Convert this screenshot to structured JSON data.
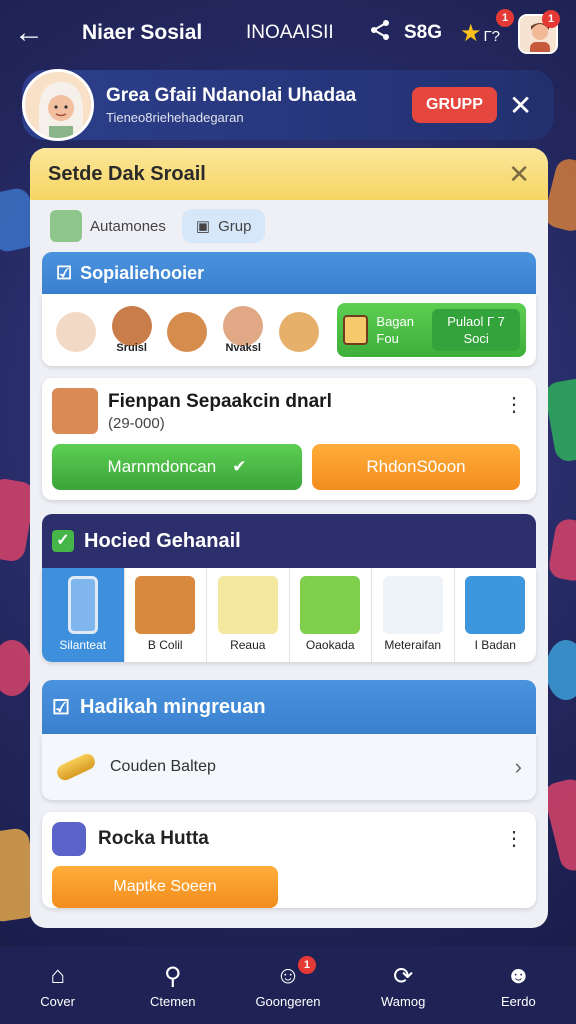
{
  "topbar": {
    "title": "Niaer Sosial",
    "subtitle": "INOAAISII",
    "score": "S8G",
    "star_count": "Г?",
    "notif_star": "1",
    "notif_avatar": "1"
  },
  "banner": {
    "name": "Grea Gfaii Ndanolai Uhadaa",
    "sub": "Tieneo8riehehadegaran",
    "button": "GRUPP"
  },
  "panel": {
    "title": "Setde Dak Sroail",
    "tabs": [
      {
        "label": "Autamones"
      },
      {
        "label": "Grup"
      }
    ],
    "section1": {
      "title": "Sopialiehooier",
      "friends": [
        {
          "name": ""
        },
        {
          "name": "Sruisl"
        },
        {
          "name": ""
        },
        {
          "name": "Nvaksl"
        },
        {
          "name": ""
        }
      ],
      "promo_text": "Bagan Fou",
      "promo_button": "Pulaol Г 7 Soci"
    },
    "request": {
      "name": "Fienpan Sepaakcin dnarl",
      "sub": "(29-000)",
      "accept": "Marnmdoncan",
      "decline": "RhdonS0oon"
    },
    "section2": {
      "title": "Hocied Gehanail",
      "games": [
        {
          "label": "Silanteat"
        },
        {
          "label": "B Colil"
        },
        {
          "label": "Reaua"
        },
        {
          "label": "Oaokada"
        },
        {
          "label": "Meteraifan"
        },
        {
          "label": "I Badan"
        }
      ]
    },
    "section3": {
      "title": "Hadikah mingreuan",
      "item": "Couden Baltep"
    },
    "bottom": {
      "name": "Rocka Hutta",
      "button": "Maptke Soeen"
    }
  },
  "nav": [
    {
      "label": "Cover",
      "icon": "house-icon"
    },
    {
      "label": "Ctemen",
      "icon": "magnifier-icon"
    },
    {
      "label": "Goongeren",
      "icon": "smile-icon",
      "badge": "1"
    },
    {
      "label": "Wamog",
      "icon": "refresh-icon"
    },
    {
      "label": "Eerdo",
      "icon": "person-icon"
    }
  ],
  "colors": {
    "accent_blue": "#3a80cf",
    "green": "#3eae3a",
    "orange": "#f28d1e",
    "red": "#e5473f",
    "yellow_header": "#f6d564"
  }
}
